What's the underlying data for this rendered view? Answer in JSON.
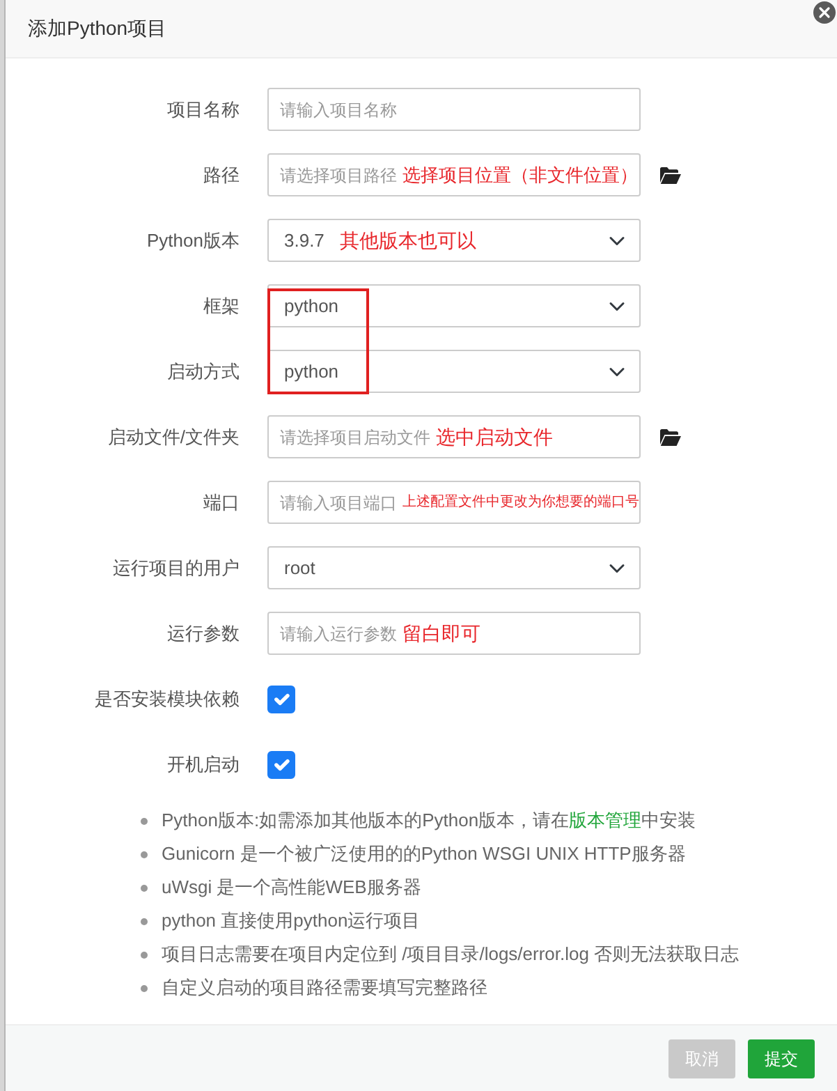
{
  "dialog": {
    "title": "添加Python项目"
  },
  "fields": [
    {
      "kind": "input",
      "label": "项目名称",
      "placeholder": "请输入项目名称"
    },
    {
      "kind": "input",
      "label": "路径",
      "placeholder": "请选择项目路径",
      "browse": true,
      "note": "选择项目位置（非文件位置）"
    },
    {
      "kind": "select",
      "label": "Python版本",
      "value": "3.9.7",
      "note": "其他版本也可以"
    },
    {
      "kind": "select",
      "label": "框架",
      "value": "python",
      "boxed": true
    },
    {
      "kind": "select",
      "label": "启动方式",
      "value": "python",
      "boxed": true
    },
    {
      "kind": "input",
      "label": "启动文件/文件夹",
      "placeholder": "请选择项目启动文件",
      "browse": true,
      "note": "选中启动文件"
    },
    {
      "kind": "input",
      "label": "端口",
      "placeholder": "请输入项目端口",
      "note": "上述配置文件中更改为你想要的端口号"
    },
    {
      "kind": "select",
      "label": "运行项目的用户",
      "value": "root"
    },
    {
      "kind": "input",
      "label": "运行参数",
      "placeholder": "请输入运行参数",
      "note": "留白即可"
    },
    {
      "kind": "checkbox",
      "label": "是否安装模块依赖",
      "checked": true
    },
    {
      "kind": "checkbox",
      "label": "开机启动",
      "checked": true
    }
  ],
  "tips": [
    {
      "text": "Python版本:如需添加其他版本的Python版本，请在",
      "link": "版本管理",
      "text_after": "中安装"
    },
    {
      "text": "Gunicorn 是一个被广泛使用的的Python WSGI UNIX HTTP服务器"
    },
    {
      "text": "uWsgi 是一个高性能WEB服务器"
    },
    {
      "text": "python 直接使用python运行项目"
    },
    {
      "text": "项目日志需要在项目内定位到 /项目目录/logs/error.log 否则无法获取日志"
    },
    {
      "text": "自定义启动的项目路径需要填写完整路径"
    }
  ],
  "buttons": [
    {
      "kind": "cancel",
      "label": "取消"
    },
    {
      "kind": "submit",
      "label": "提交"
    }
  ]
}
